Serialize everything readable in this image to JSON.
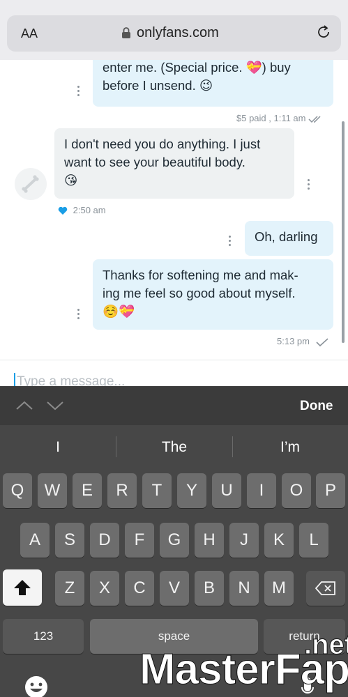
{
  "browser": {
    "text_size_label": "AA",
    "url": "onlyfans.com"
  },
  "chat": {
    "messages": [
      {
        "text_line1": "enter me. (Special price. 💝) buy",
        "text_line2": "before I unsend. 😉",
        "meta": "$5 paid , 1:11 am"
      },
      {
        "text_line1": "I don't need you do anything. I just",
        "text_line2": "want to see your beautiful body.",
        "text_line3": "😘",
        "meta": "2:50 am"
      },
      {
        "text": "Oh, darling"
      },
      {
        "text_line1": "Thanks for softening me and mak-",
        "text_line2": "ing me feel so good about myself.",
        "text_line3": "☺️💝",
        "meta": "5:13 pm"
      }
    ]
  },
  "input": {
    "placeholder": "Type a message..."
  },
  "keyboard": {
    "done_label": "Done",
    "suggestions": [
      "I",
      "The",
      "I’m"
    ],
    "row1": [
      "Q",
      "W",
      "E",
      "R",
      "T",
      "Y",
      "U",
      "I",
      "O",
      "P"
    ],
    "row2": [
      "A",
      "S",
      "D",
      "F",
      "G",
      "H",
      "J",
      "K",
      "L"
    ],
    "row3": [
      "Z",
      "X",
      "C",
      "V",
      "B",
      "N",
      "M"
    ],
    "numbers_label": "123",
    "space_label": "space",
    "return_label": "return"
  },
  "watermark": {
    "brand": "MasterFap",
    "tld": ".net"
  },
  "colors": {
    "accent": "#1a9ee6",
    "bubble_out": "#e3f3fb",
    "bubble_in": "#eef1f2",
    "keyboard_bg": "#474747"
  }
}
